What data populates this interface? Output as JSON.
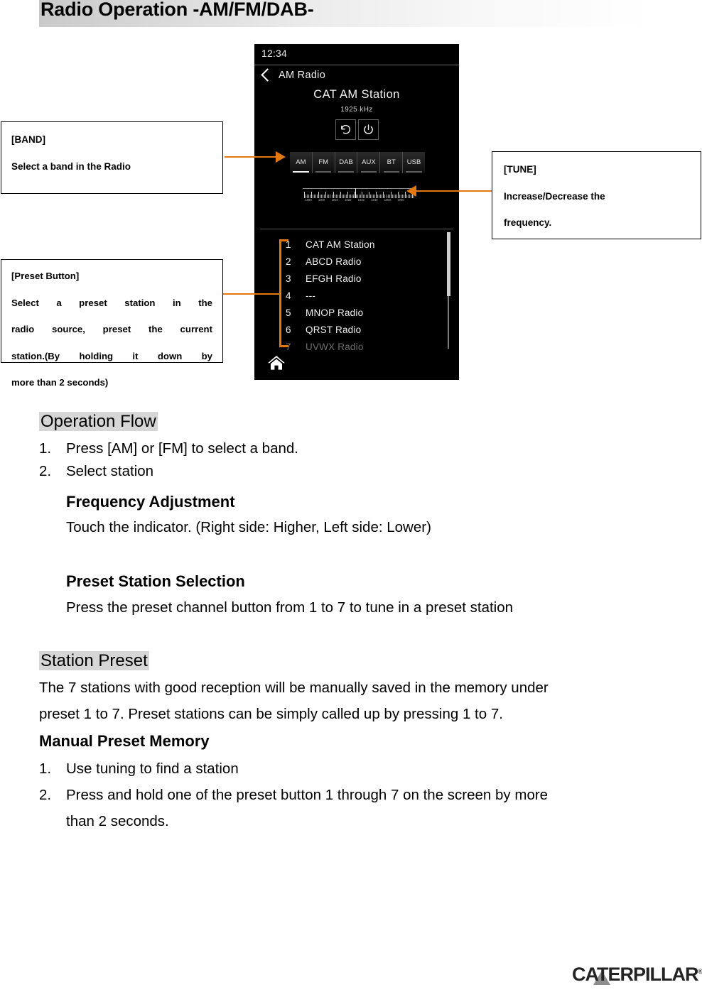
{
  "page": {
    "title": "Radio Operation -AM/FM/DAB-",
    "brand": "CATERPILLAR",
    "brand_mark": "®"
  },
  "device": {
    "clock": "12:34",
    "back_label": "AM Radio",
    "station_name": "CAT AM Station",
    "frequency": "1925 kHz",
    "icon_buttons": [
      {
        "name": "undo-arrow-icon",
        "label": "↺"
      },
      {
        "name": "power-icon",
        "label": "⏻"
      }
    ],
    "bands": [
      {
        "label": "AM",
        "selected": true
      },
      {
        "label": "FM",
        "selected": false
      },
      {
        "label": "DAB",
        "selected": false
      },
      {
        "label": "AUX",
        "selected": false
      },
      {
        "label": "BT",
        "selected": false
      },
      {
        "label": "USB",
        "selected": false
      }
    ],
    "scale_labels": [
      "1890",
      "1900",
      "1910",
      "1920",
      "1930",
      "1940",
      "1950",
      "1960"
    ],
    "presets": [
      {
        "num": "1",
        "name": "CAT AM Station",
        "dim": false
      },
      {
        "num": "2",
        "name": "ABCD Radio",
        "dim": false
      },
      {
        "num": "3",
        "name": "EFGH Radio",
        "dim": false
      },
      {
        "num": "4",
        "name": "---",
        "dim": false
      },
      {
        "num": "5",
        "name": "MNOP Radio",
        "dim": false
      },
      {
        "num": "6",
        "name": "QRST Radio",
        "dim": false
      },
      {
        "num": "7",
        "name": "UVWX Radio",
        "dim": true
      }
    ],
    "home_icon": "home-icon"
  },
  "callouts": {
    "band": {
      "title": "[BAND]",
      "line1": "Select a band in the Radio"
    },
    "tune": {
      "title": "[TUNE]",
      "line1": "Increase/Decrease the",
      "line2": "frequency."
    },
    "preset": {
      "title": "[Preset Button]",
      "line1": "Select a preset station in the",
      "line2": "radio source, preset the current",
      "line3": "station.(By holding it down by",
      "line4": "more than 2 seconds)"
    }
  },
  "content": {
    "operation_flow_heading": "Operation Flow",
    "operation_flow_items": [
      {
        "n": "1.",
        "text": "Press [AM] or [FM] to select a band."
      },
      {
        "n": "2.",
        "text": "Select station"
      }
    ],
    "frequency_adjustment_heading": "Frequency Adjustment",
    "frequency_adjustment_body": "Touch the indicator. (Right side: Higher, Left side: Lower)",
    "preset_station_heading": "Preset Station Selection",
    "preset_station_body": "Press the preset channel button from 1 to 7 to tune in a preset station",
    "station_preset_heading": "Station Preset",
    "station_preset_body_line1": "The 7 stations with good reception will be manually saved in the memory under",
    "station_preset_body_line2": "preset 1 to 7. Preset stations can be simply called up by pressing 1 to 7.",
    "manual_preset_heading": "Manual Preset Memory",
    "manual_preset_items": [
      {
        "n": "1.",
        "text": "Use tuning to find a station"
      },
      {
        "n": "2.",
        "text": "Press and hold one of the preset button 1 through 7 on the screen by more"
      },
      {
        "n": "",
        "text": "than 2 seconds."
      }
    ]
  },
  "colors": {
    "accent_orange": "#e3780e",
    "highlight_gray": "#d6d6d6",
    "screen_black": "#000000"
  }
}
